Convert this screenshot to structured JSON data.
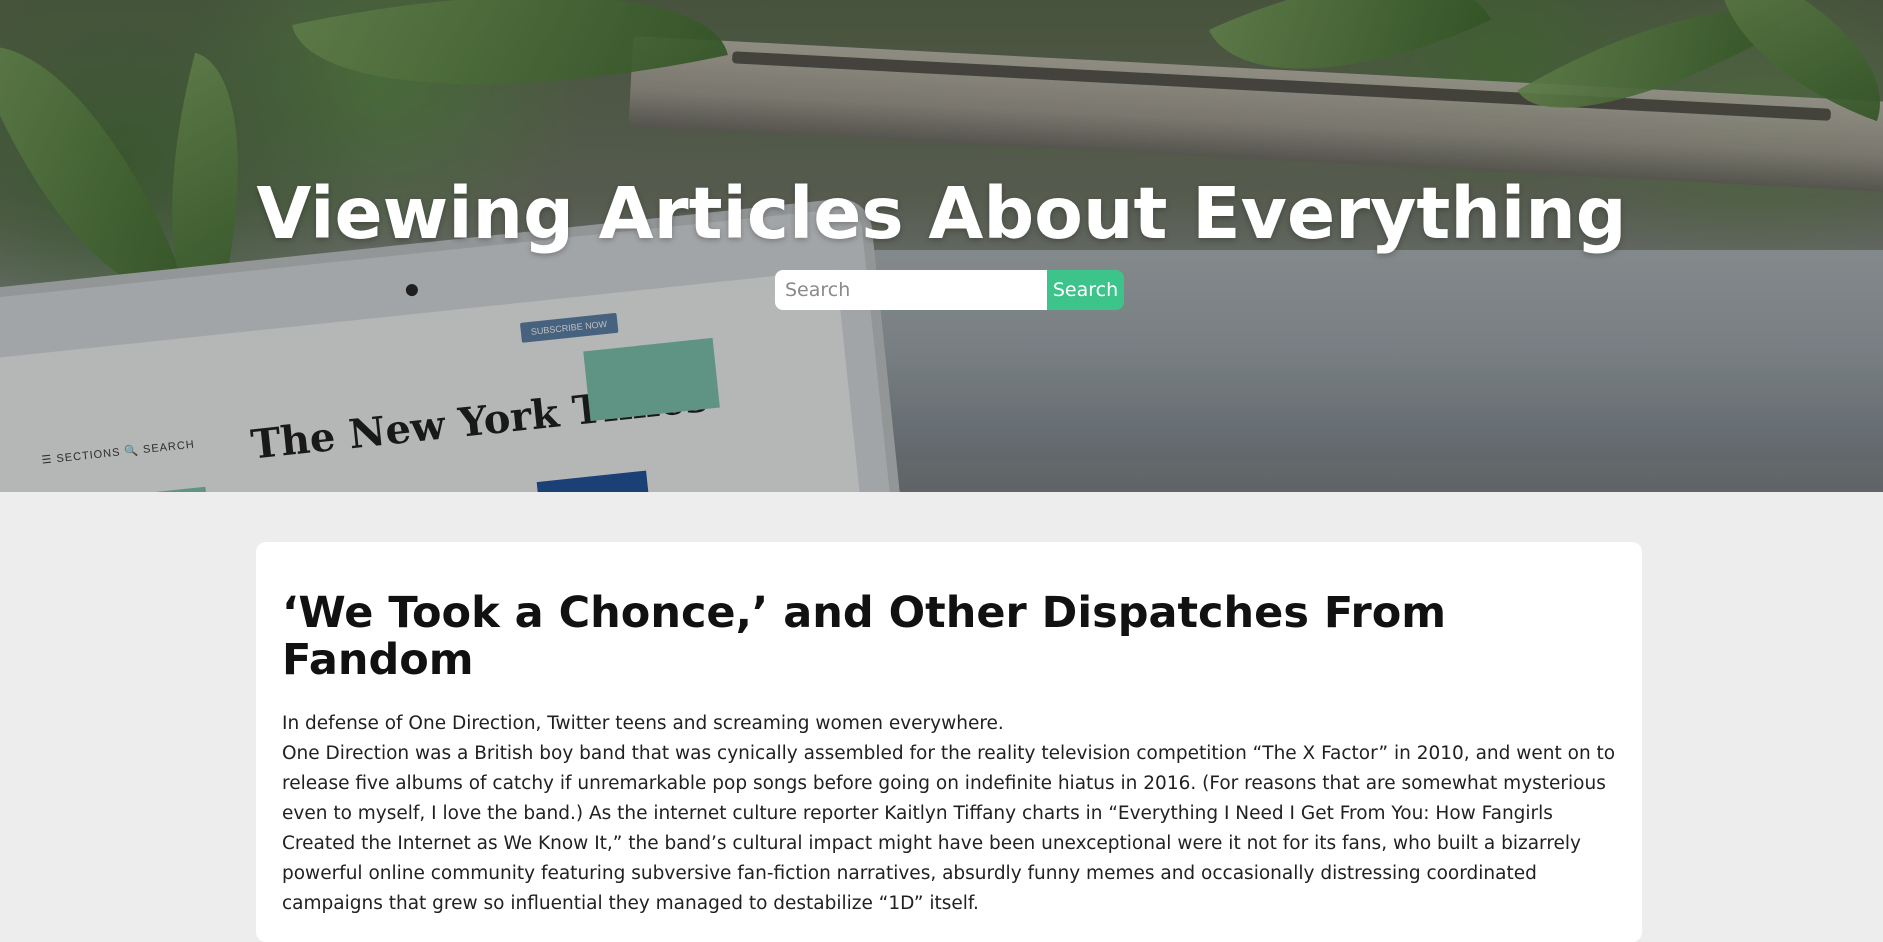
{
  "hero": {
    "title": "Viewing Articles About Everything",
    "search": {
      "placeholder": "Search",
      "value": "",
      "button_label": "Search"
    },
    "background_image": {
      "masthead_text": "The New York Times",
      "sections_text": "☰ SECTIONS   🔍 SEARCH"
    }
  },
  "colors": {
    "accent": "#3cc48a",
    "page_background": "#ededed",
    "card_background": "#ffffff"
  },
  "articles": [
    {
      "title": "‘We Took a Chonce,’ and Other Dispatches From Fandom",
      "summary": "In defense of One Direction, Twitter teens and screaming women everywhere.",
      "body": "One Direction was a British boy band that was cynically assembled for the reality television competition “The X Factor” in 2010, and went on to release five albums of catchy if unremarkable pop songs before going on indefinite hiatus in 2016. (For reasons that are somewhat mysterious even to myself, I love the band.) As the internet culture reporter Kaitlyn Tiffany charts in “Everything I Need I Get From You: How Fangirls Created the Internet as We Know It,” the band’s cultural impact might have been unexceptional were it not for its fans, who built a bizarrely powerful online community featuring subversive fan-fiction narratives, absurdly funny memes and occasionally distressing coordinated campaigns that grew so influential they managed to destabilize “1D” itself."
    }
  ]
}
